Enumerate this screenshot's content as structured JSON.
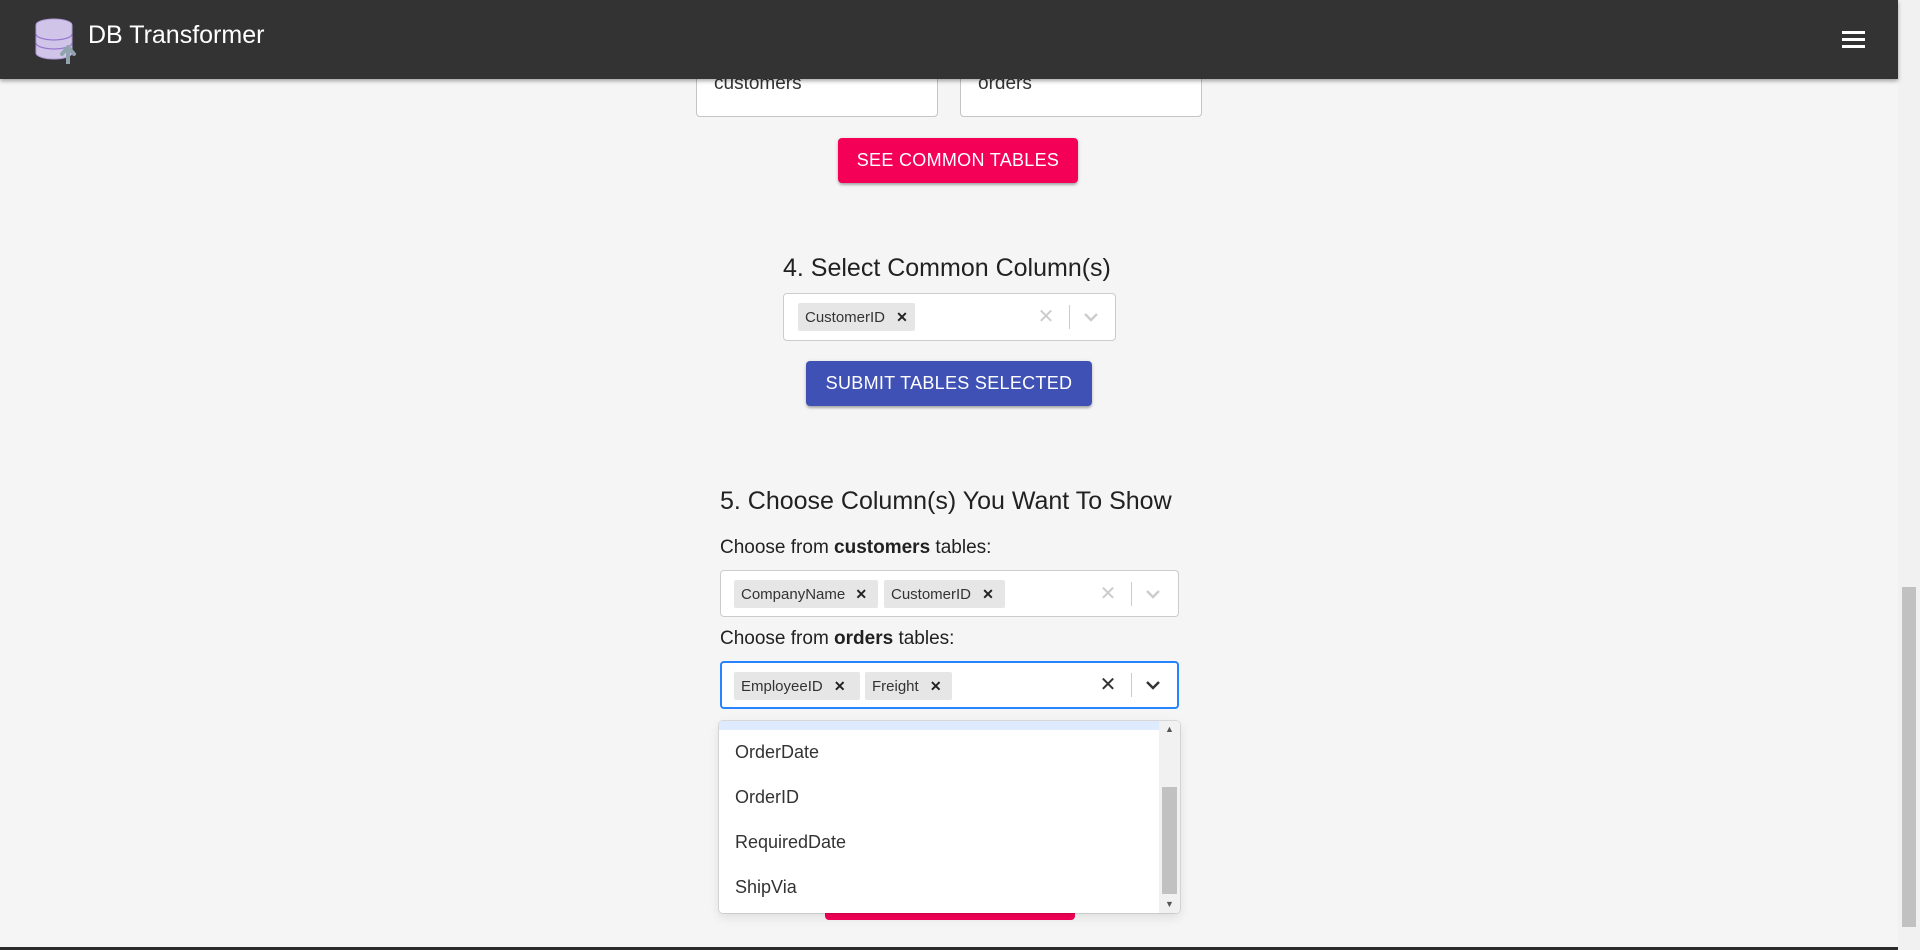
{
  "app": {
    "title": "DB Transformer"
  },
  "tables": {
    "left": "customers",
    "right": "orders"
  },
  "buttons": {
    "see_common": "SEE COMMON TABLES",
    "submit_tables": "SUBMIT TABLES SELECTED"
  },
  "step4": {
    "heading": "4. Select Common Column(s)",
    "selected": [
      "CustomerID"
    ]
  },
  "step5": {
    "heading": "5. Choose Column(s) You Want To Show",
    "customers": {
      "prefix": "Choose from ",
      "table": "customers",
      "suffix": " tables:",
      "selected": [
        "CompanyName",
        "CustomerID"
      ]
    },
    "orders": {
      "prefix": "Choose from ",
      "table": "orders",
      "suffix": " tables:",
      "selected": [
        "EmployeeID",
        "Freight"
      ]
    }
  },
  "dropdown": {
    "options": [
      "OrderDate",
      "OrderID",
      "RequiredDate",
      "ShipVia"
    ]
  },
  "colors": {
    "appbar": "#333333",
    "pink": "#f50057",
    "indigo": "#3f51b5",
    "focus": "#2684ff"
  },
  "icons": {
    "menu": "hamburger-menu-icon",
    "logo": "database-upload-icon",
    "remove": "close-icon",
    "clear": "clear-icon",
    "dropdown": "chevron-down-icon"
  }
}
